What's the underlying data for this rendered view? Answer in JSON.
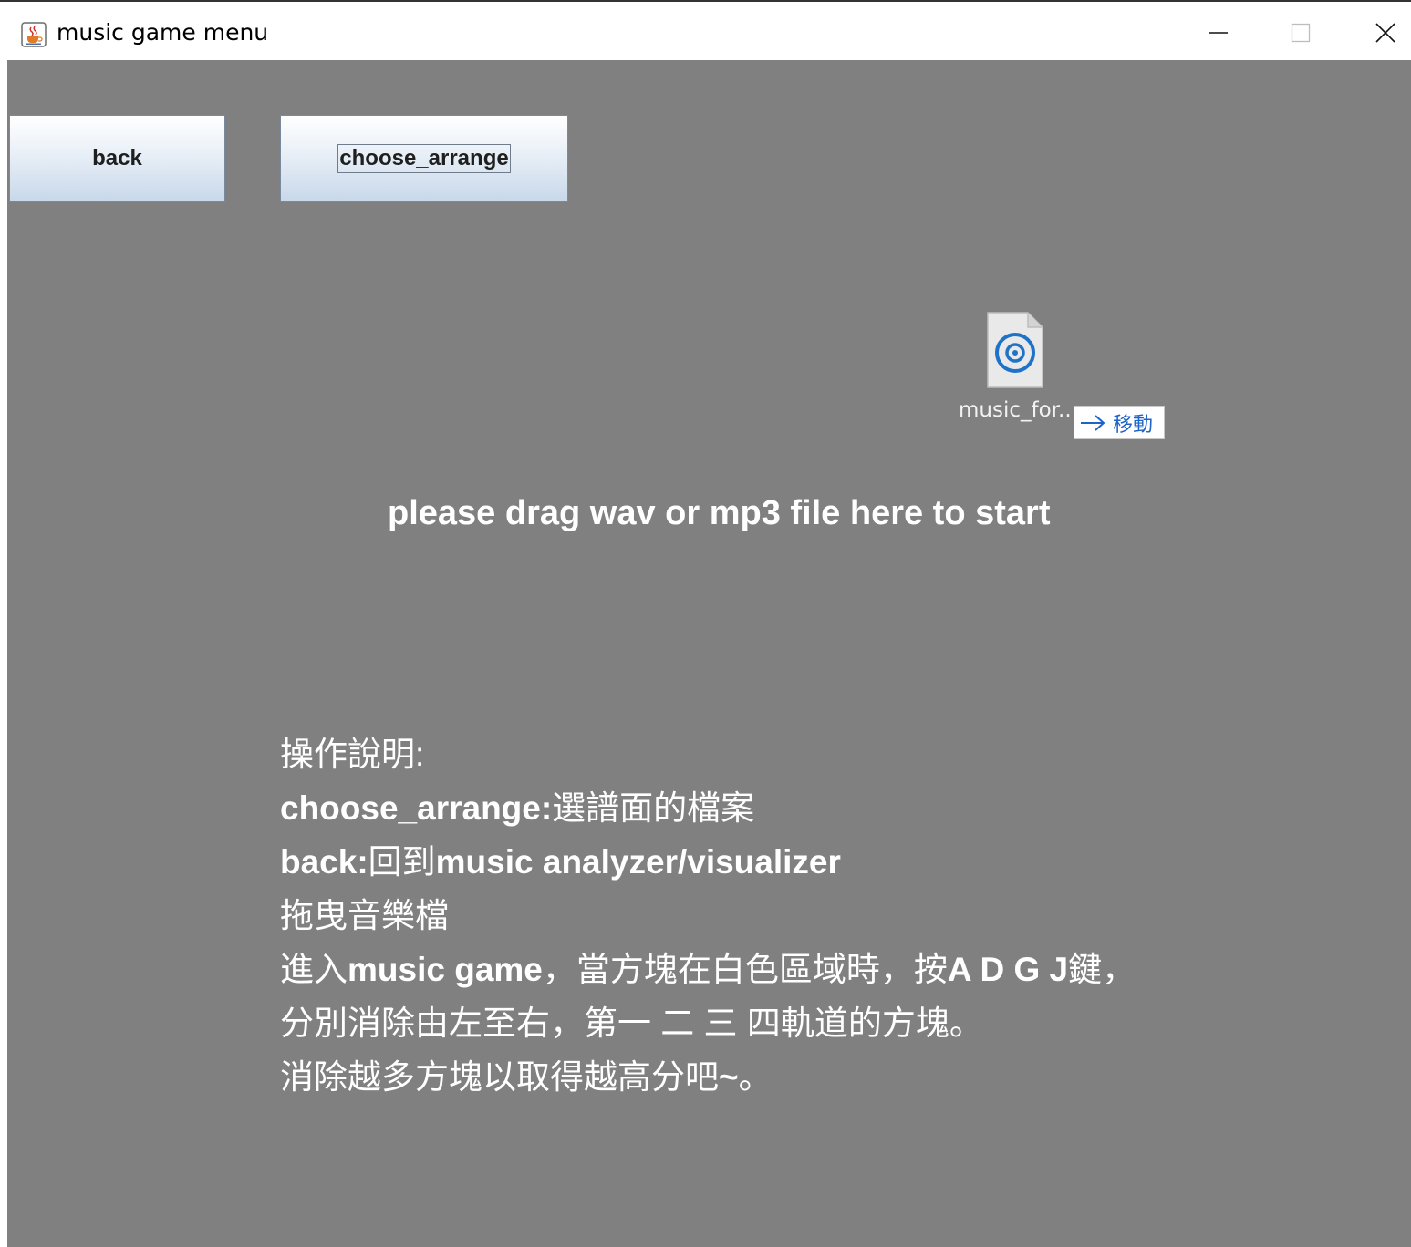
{
  "window": {
    "title": "music game menu",
    "icon": "java-cup-icon",
    "controls": {
      "minimize": "minimize-icon",
      "maximize": "maximize-icon",
      "close": "close-icon"
    }
  },
  "buttons": {
    "back_label": "back",
    "choose_label": "choose_arrange"
  },
  "drag_file": {
    "name": "music_for...",
    "icon": "audio-file-icon",
    "tooltip_label": "移動",
    "tooltip_icon": "arrow-right-icon"
  },
  "drag_hint": "please drag wav or mp3 file here to start",
  "instructions": [
    [
      "操作說明:"
    ],
    [
      "choose_arrange:",
      "選譜面的檔案"
    ],
    [
      "back:",
      "回到",
      "music analyzer/visualizer"
    ],
    [
      "拖曳音樂檔"
    ],
    [
      "進入",
      "music game",
      "，當方塊在白色區域時，按",
      "A D G J",
      "鍵，"
    ],
    [
      "分別消除由左至右，第一 二 三 四軌道的方塊。"
    ],
    [
      "消除越多方塊以取得越高分吧",
      "~",
      "。"
    ]
  ],
  "colors": {
    "background": "#808080",
    "text": "#ffffff",
    "tooltip_text": "#1e63c8",
    "file_icon_accent": "#1e73c8"
  }
}
